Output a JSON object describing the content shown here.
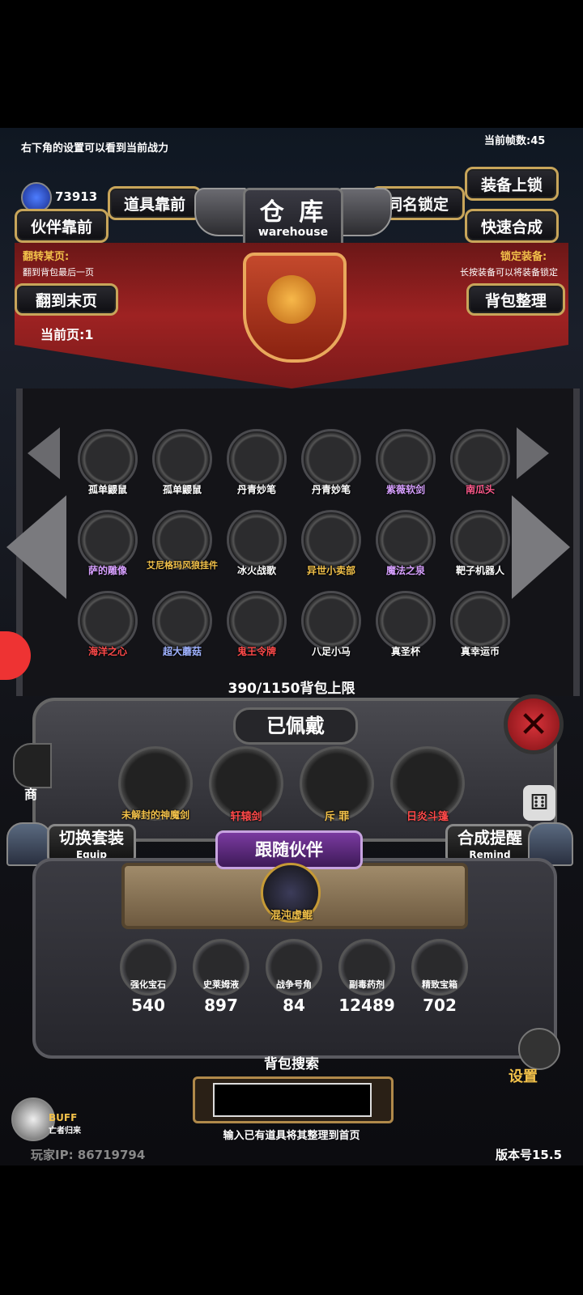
{
  "hud": {
    "tip": "右下角的设置可以看到当前战力",
    "fps": "当前帧数:45",
    "gem_count": "73913"
  },
  "top_buttons": {
    "items_front": "道具靠前",
    "companion_front": "伙伴靠前",
    "same_name_lock": "同名锁定",
    "equip_lock": "装备上锁",
    "quick_merge": "快速合成",
    "last_page": "翻到末页",
    "bag_sort": "背包整理"
  },
  "warehouse": {
    "title": "仓 库",
    "subtitle": "warehouse"
  },
  "page_info": {
    "flip_label": "翻转某页:",
    "flip_desc": "翻到背包最后一页",
    "lock_label": "锁定装备:",
    "lock_desc": "长按装备可以将装备锁定",
    "current_page": "当前页:1"
  },
  "grid": [
    {
      "label": "孤单鼹鼠",
      "color": "#ffffff"
    },
    {
      "label": "孤单鼹鼠",
      "color": "#ffffff"
    },
    {
      "label": "丹青妙笔",
      "color": "#ffffff"
    },
    {
      "label": "丹青妙笔",
      "color": "#ffffff"
    },
    {
      "label": "紫薇软剑",
      "color": "#d7a0ff"
    },
    {
      "label": "南瓜头",
      "color": "#ff5a8c"
    },
    {
      "label": "萨的雕像",
      "color": "#d7a0ff"
    },
    {
      "label": "艾尼格玛风狼挂件",
      "color": "#f2c14a"
    },
    {
      "label": "冰火战歌",
      "color": "#ffffff"
    },
    {
      "label": "异世小卖部",
      "color": "#f2c14a"
    },
    {
      "label": "魔法之泉",
      "color": "#d7a0ff"
    },
    {
      "label": "靶子机器人",
      "color": "#ffffff"
    },
    {
      "label": "海洋之心",
      "color": "#ff4a4a"
    },
    {
      "label": "超大蘑菇",
      "color": "#9fb2ff"
    },
    {
      "label": "鬼王令牌",
      "color": "#ff4a4a"
    },
    {
      "label": "八足小马",
      "color": "#ffffff"
    },
    {
      "label": "真圣杯",
      "color": "#ffffff"
    },
    {
      "label": "真幸运币",
      "color": "#ffffff"
    }
  ],
  "capacity": "390/1150背包上限",
  "equipped": {
    "title": "已佩戴",
    "items": [
      {
        "label": "未解封的神魔剑",
        "color": "#f2c14a"
      },
      {
        "label": "轩辕剑",
        "color": "#ff4a4a"
      },
      {
        "label": "斥 罪",
        "color": "#f2c14a"
      },
      {
        "label": "日炎斗篷",
        "color": "#ff4a4a"
      }
    ]
  },
  "side": {
    "switch_set": "切换套装",
    "switch_sub": "Equip",
    "merge_remind": "合成提醒",
    "merge_sub": "Remind",
    "shop": "商",
    "settings": "设置"
  },
  "companion": {
    "title": "跟随伙伴",
    "name": "混沌虚鲲"
  },
  "resources": [
    {
      "label": "强化宝石",
      "count": "540"
    },
    {
      "label": "史莱姆液",
      "count": "897"
    },
    {
      "label": "战争号角",
      "count": "84"
    },
    {
      "label": "副毒药剂",
      "count": "12489"
    },
    {
      "label": "精致宝箱",
      "count": "702"
    }
  ],
  "search": {
    "title": "背包搜索",
    "hint": "输入已有道具将其整理到首页",
    "value": ""
  },
  "footer": {
    "buff": "BUFF",
    "buff_sub": "亡者归来",
    "player_ip": "玩家IP:  86719794",
    "version": "版本号15.5"
  }
}
